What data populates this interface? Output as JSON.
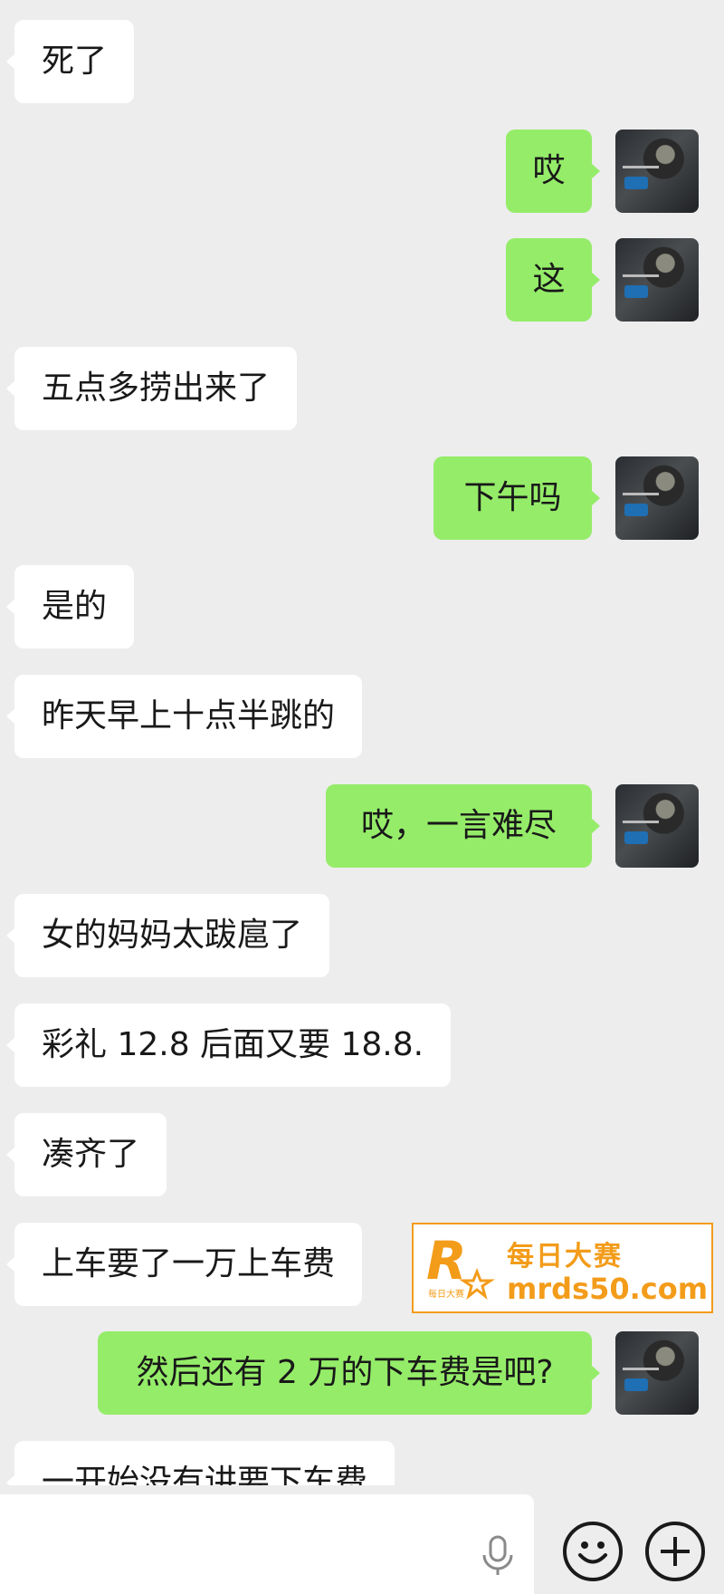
{
  "messages": [
    {
      "dir": "in",
      "text": "死了"
    },
    {
      "dir": "out",
      "text": "哎"
    },
    {
      "dir": "out",
      "text": "这"
    },
    {
      "dir": "in",
      "text": "五点多捞出来了"
    },
    {
      "dir": "out",
      "text": "下午吗"
    },
    {
      "dir": "in",
      "text": "是的"
    },
    {
      "dir": "in",
      "text": "昨天早上十点半跳的"
    },
    {
      "dir": "out",
      "text": "哎，一言难尽"
    },
    {
      "dir": "in",
      "text": "女的妈妈太跋扈了"
    },
    {
      "dir": "in",
      "text": "彩礼 12.8 后面又要 18.8."
    },
    {
      "dir": "in",
      "text": "凑齐了"
    },
    {
      "dir": "in",
      "text": "上车要了一万上车费"
    },
    {
      "dir": "out",
      "text": "然后还有 2 万的下车费是吧?"
    },
    {
      "dir": "in",
      "text": "一开始没有讲要下车费"
    }
  ],
  "input_bar": {
    "voice_icon": "microphone-icon",
    "emoji_icon": "smiley-icon",
    "more_icon": "plus-icon"
  },
  "watermark": {
    "logo_letter": "R",
    "logo_caption": "每日大赛",
    "title": "每日大赛",
    "url": "mrds50.com",
    "color": "#f39c1a"
  },
  "colors": {
    "background": "#ededed",
    "incoming_bubble": "#ffffff",
    "outgoing_bubble": "#95ec69"
  }
}
